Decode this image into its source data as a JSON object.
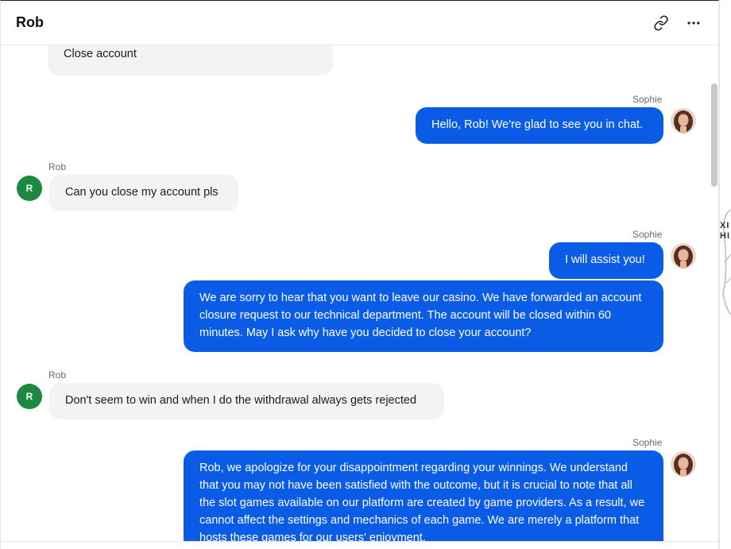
{
  "header": {
    "title": "Rob",
    "link_icon": "link-icon",
    "menu_icon": "more-horizontal-icon"
  },
  "agent_name": "Sophie",
  "customer_name": "Rob",
  "customer_initial": "R",
  "messages": [
    {
      "from": "customer",
      "text": "Close account"
    },
    {
      "from": "agent",
      "sender": "Sophie",
      "text": "Hello, Rob! We're glad to see you in chat."
    },
    {
      "from": "customer",
      "sender": "Rob",
      "text": "Can you close my account pls"
    },
    {
      "from": "agent",
      "sender": "Sophie",
      "text": "I will assist you!"
    },
    {
      "from": "agent",
      "text": "We are sorry to hear that you want to leave our casino. We have forwarded an account closure request to our technical department. The account will be closed within 60 minutes. May I ask why have you decided to close your account?"
    },
    {
      "from": "customer",
      "sender": "Rob",
      "text": "Don't seem to win and when I do the withdrawal always gets rejected"
    },
    {
      "from": "agent",
      "sender": "Sophie",
      "text": "Rob, we apologize for your disappointment regarding your winnings. We understand that you may not have been satisfied with the outcome, but it is crucial to note that all the slot games available on our platform are created by game providers. As a result, we cannot affect the settings and mechanics of each game. We are merely a platform that hosts these games for our users' enjoyment."
    }
  ],
  "right_edge_text": [
    "XI",
    "HI"
  ],
  "colors": {
    "agent_bubble": "#0a5ce6",
    "customer_bubble": "#f3f3f4",
    "customer_avatar": "#1b8a3f"
  }
}
